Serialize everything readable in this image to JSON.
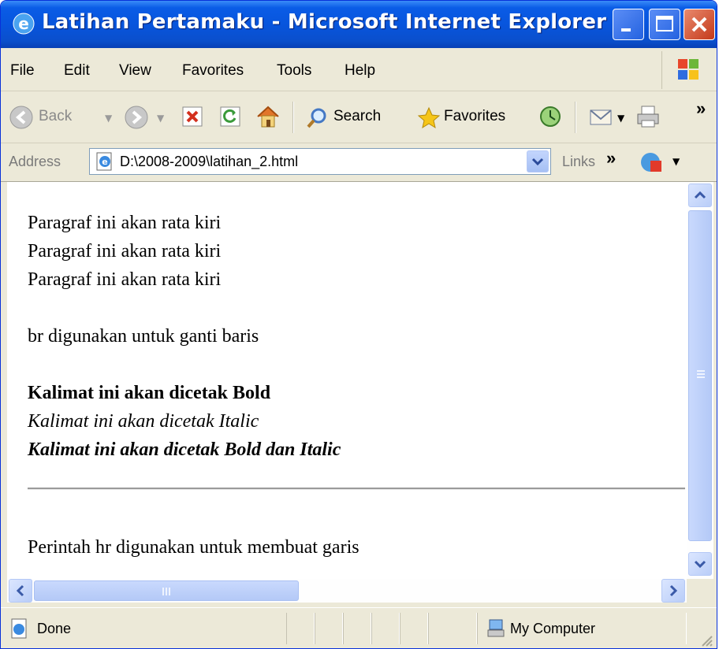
{
  "window": {
    "title": "Latihan Pertamaku - Microsoft Internet Explorer"
  },
  "menu": {
    "items": [
      "File",
      "Edit",
      "View",
      "Favorites",
      "Tools",
      "Help"
    ]
  },
  "toolbar": {
    "back_label": "Back",
    "search_label": "Search",
    "favorites_label": "Favorites",
    "overflow": "»"
  },
  "address": {
    "label": "Address",
    "value": "D:\\2008-2009\\latihan_2.html",
    "links_label": "Links",
    "links_overflow": "»"
  },
  "document": {
    "lines": [
      "Paragraf ini akan rata kiri",
      "Paragraf ini akan rata kiri",
      "Paragraf ini akan rata kiri"
    ],
    "br_text": "br digunakan untuk ganti baris",
    "bold_text": "Kalimat ini akan dicetak Bold",
    "italic_text": "Kalimat ini akan dicetak Italic",
    "bold_italic_text": "Kalimat ini akan dicetak Bold dan Italic",
    "hr_text": "Perintah hr digunakan untuk membuat garis"
  },
  "status": {
    "text": "Done",
    "zone": "My Computer"
  }
}
